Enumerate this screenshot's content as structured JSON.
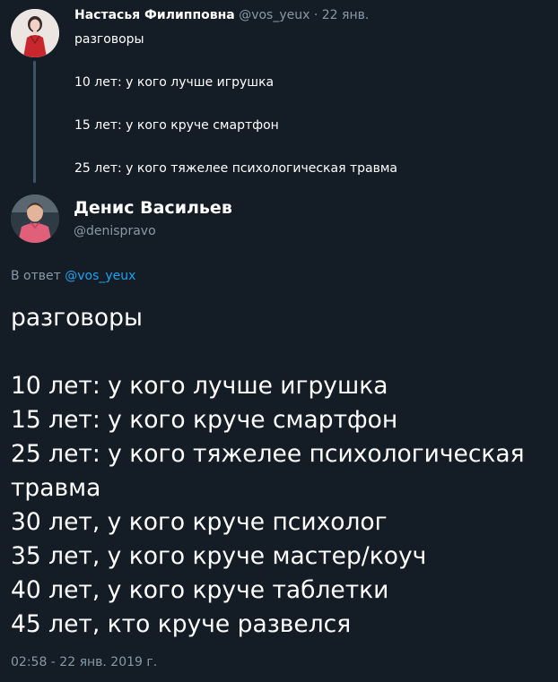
{
  "colors": {
    "background": "#141d26",
    "text_primary": "#ffffff",
    "text_secondary": "#8899a6",
    "link": "#1da1f2",
    "thread_line": "#3d5466"
  },
  "parent_tweet": {
    "avatar_icon": "user-avatar-icon",
    "author_name": "Настасья Филипповна",
    "author_handle": "@vos_yeux",
    "separator": "·",
    "date": "22 янв.",
    "text_lines": [
      "разговоры",
      "10 лет: у кого лучше игрушка",
      "15 лет: у кого круче смартфон",
      "25 лет: у кого тяжелее психологическая травма"
    ]
  },
  "reply_tweet": {
    "avatar_icon": "user-avatar-icon",
    "author_name": "Денис Васильев",
    "author_handle": "@denispravo",
    "reply_prefix": "В ответ",
    "reply_mention": "@vos_yeux",
    "text_lines": [
      "разговоры",
      "10 лет: у кого лучше игрушка",
      "15 лет: у кого круче смартфон",
      "25 лет: у кого тяжелее психологическая",
      "травма",
      "30 лет, у кого круче психолог",
      "35 лет, у кого круче мастер/коуч",
      "40 лет, у кого круче таблетки",
      "45 лет, кто круче развелся"
    ],
    "timestamp": "02:58 - 22 янв. 2019 г."
  }
}
